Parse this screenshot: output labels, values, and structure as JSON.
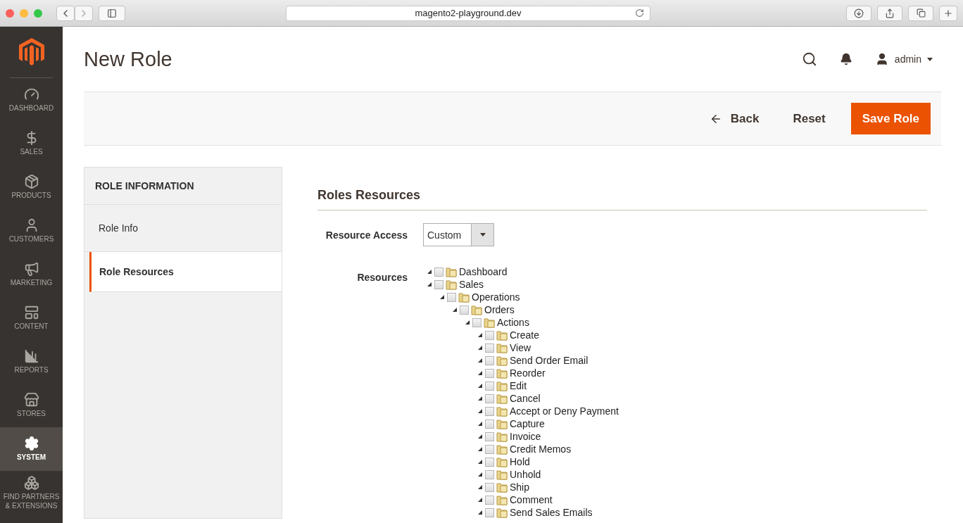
{
  "browser": {
    "url": "magento2-playground.dev"
  },
  "sidebar": {
    "items": [
      {
        "label": "DASHBOARD",
        "selected": false
      },
      {
        "label": "SALES",
        "selected": false
      },
      {
        "label": "PRODUCTS",
        "selected": false
      },
      {
        "label": "CUSTOMERS",
        "selected": false
      },
      {
        "label": "MARKETING",
        "selected": false
      },
      {
        "label": "CONTENT",
        "selected": false
      },
      {
        "label": "REPORTS",
        "selected": false
      },
      {
        "label": "STORES",
        "selected": false
      },
      {
        "label": "SYSTEM",
        "selected": true
      },
      {
        "label": "FIND PARTNERS & EXTENSIONS",
        "selected": false
      }
    ]
  },
  "header": {
    "title": "New Role",
    "user": "admin"
  },
  "actions": {
    "back": "Back",
    "reset": "Reset",
    "save": "Save Role"
  },
  "tabs_panel": {
    "title": "ROLE INFORMATION",
    "tabs": [
      {
        "label": "Role Info",
        "selected": false
      },
      {
        "label": "Role Resources",
        "selected": true
      }
    ]
  },
  "section": {
    "title": "Roles Resources",
    "access_label": "Resource Access",
    "access_value": "Custom",
    "resources_label": "Resources"
  },
  "tree": [
    {
      "label": "Dashboard",
      "checked": false
    },
    {
      "label": "Sales",
      "checked": false,
      "children": [
        {
          "label": "Operations",
          "checked": false,
          "children": [
            {
              "label": "Orders",
              "checked": false,
              "children": [
                {
                  "label": "Actions",
                  "checked": false,
                  "children": [
                    {
                      "label": "Create",
                      "checked": false
                    },
                    {
                      "label": "View",
                      "checked": false
                    },
                    {
                      "label": "Send Order Email",
                      "checked": false
                    },
                    {
                      "label": "Reorder",
                      "checked": false
                    },
                    {
                      "label": "Edit",
                      "checked": false
                    },
                    {
                      "label": "Cancel",
                      "checked": false
                    },
                    {
                      "label": "Accept or Deny Payment",
                      "checked": false
                    },
                    {
                      "label": "Capture",
                      "checked": false
                    },
                    {
                      "label": "Invoice",
                      "checked": false
                    },
                    {
                      "label": "Credit Memos",
                      "checked": false
                    },
                    {
                      "label": "Hold",
                      "checked": false
                    },
                    {
                      "label": "Unhold",
                      "checked": false
                    },
                    {
                      "label": "Ship",
                      "checked": false
                    },
                    {
                      "label": "Comment",
                      "checked": false
                    },
                    {
                      "label": "Send Sales Emails",
                      "checked": false
                    }
                  ]
                }
              ]
            }
          ]
        }
      ]
    }
  ]
}
